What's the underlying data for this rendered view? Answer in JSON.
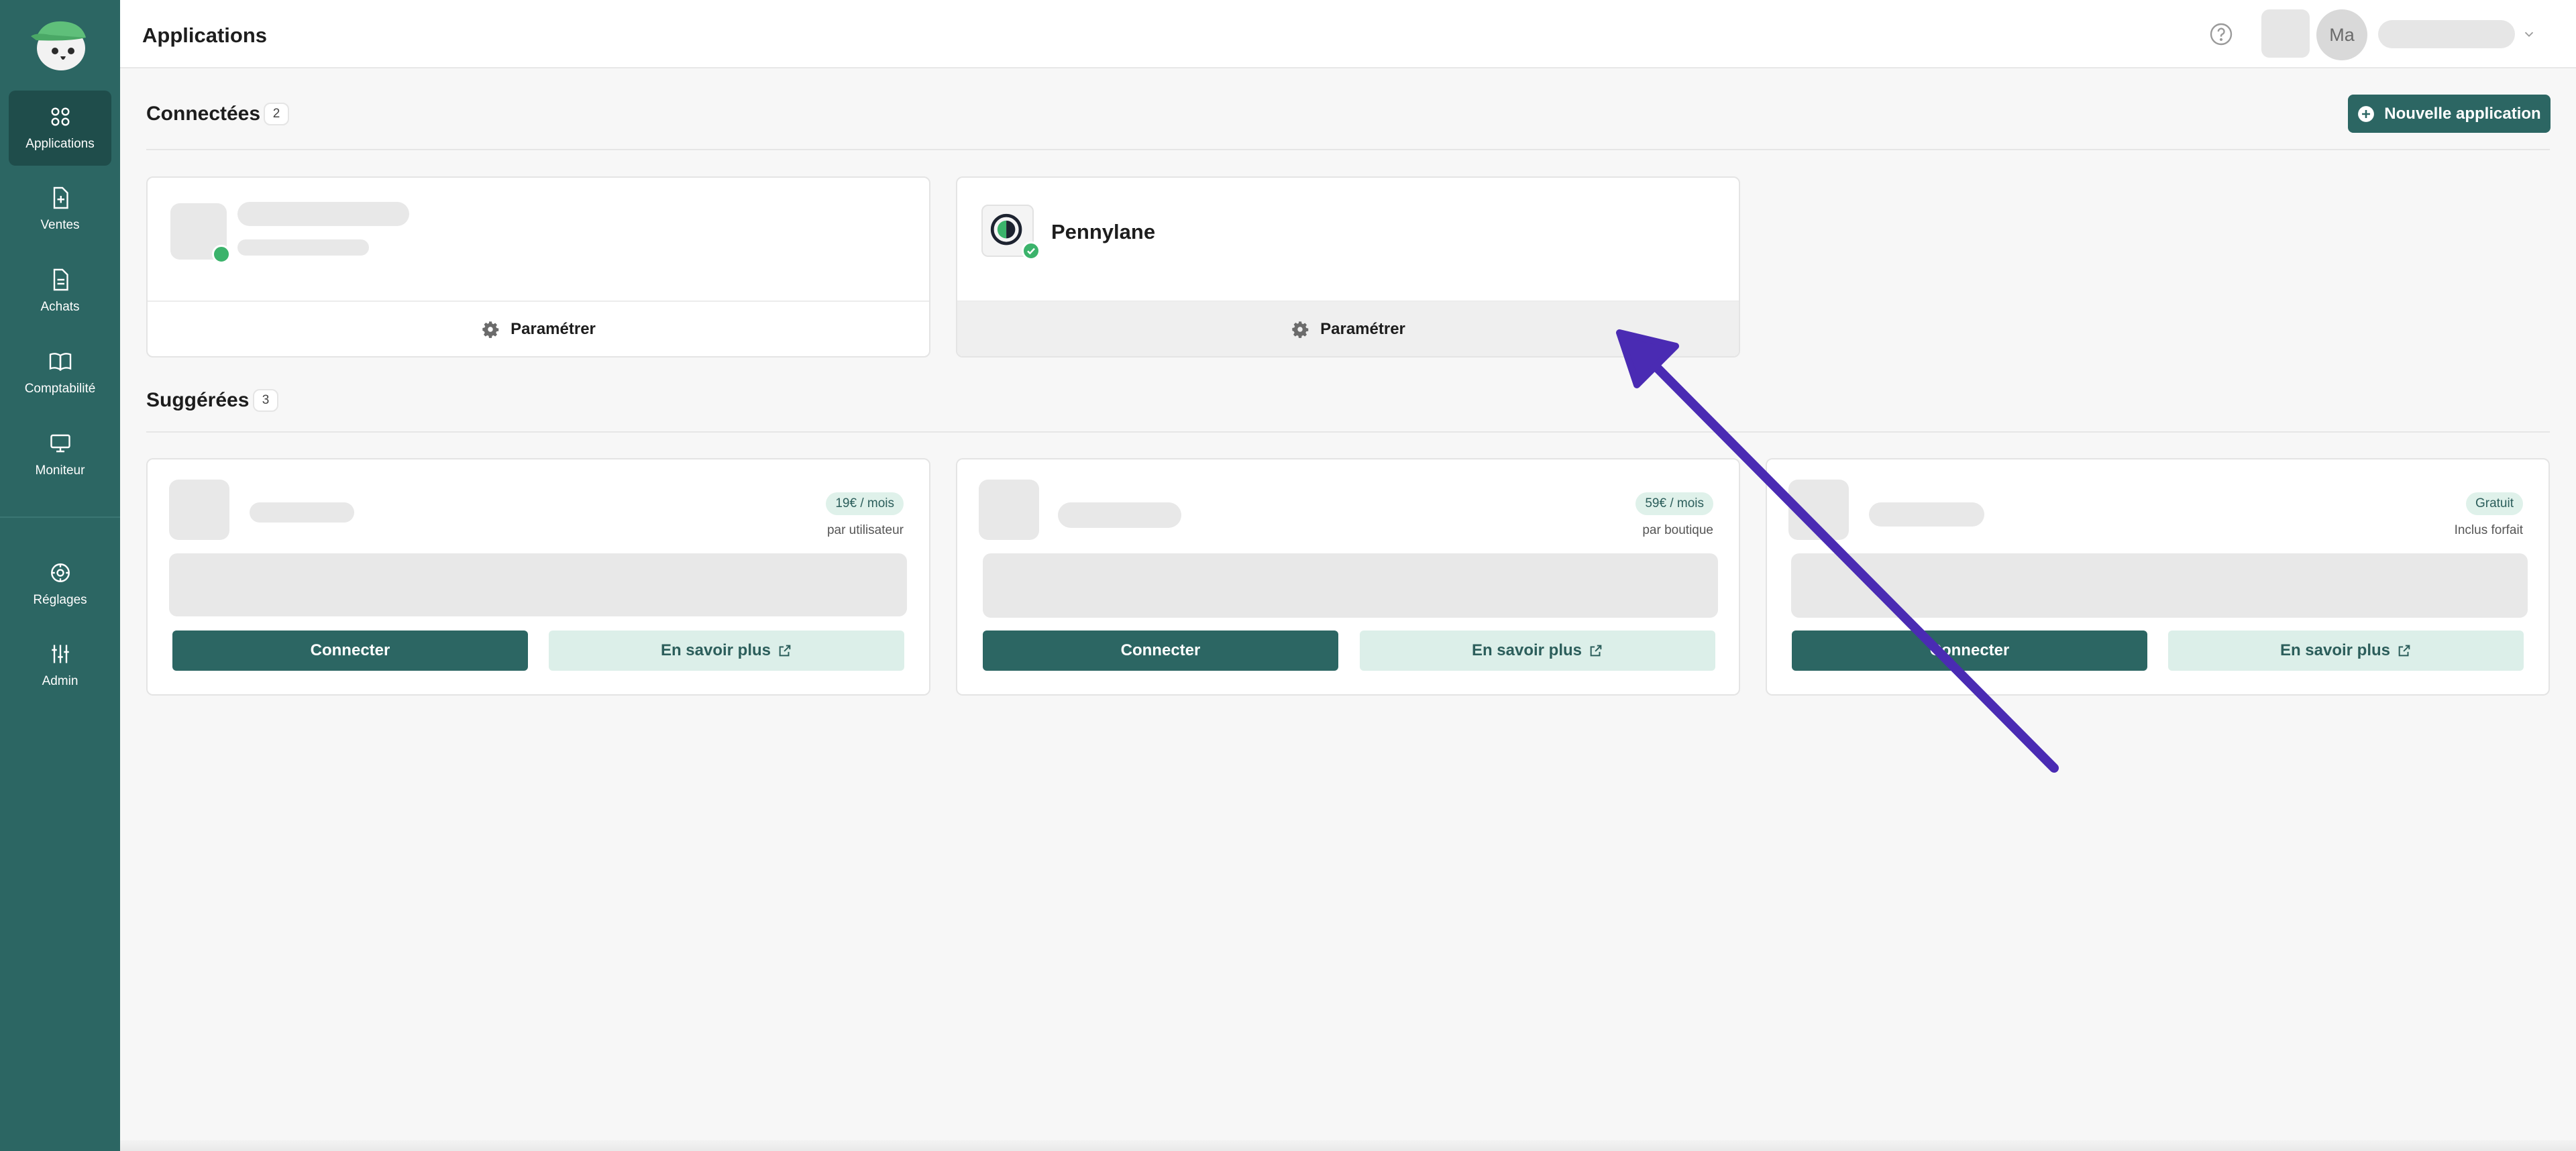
{
  "sidebar": {
    "items": [
      {
        "label": "Applications",
        "icon": "grid-icon"
      },
      {
        "label": "Ventes",
        "icon": "document-plus-icon"
      },
      {
        "label": "Achats",
        "icon": "document-icon"
      },
      {
        "label": "Comptabilité",
        "icon": "book-icon"
      },
      {
        "label": "Moniteur",
        "icon": "monitor-icon"
      },
      {
        "label": "Réglages",
        "icon": "gear-icon"
      },
      {
        "label": "Admin",
        "icon": "sliders-icon"
      }
    ]
  },
  "header": {
    "title": "Applications",
    "avatar_initials": "Ma"
  },
  "connected": {
    "title": "Connectées",
    "count": "2",
    "new_app_label": "Nouvelle application",
    "cards": [
      {
        "name": "",
        "action_label": "Paramétrer"
      },
      {
        "name": "Pennylane",
        "action_label": "Paramétrer"
      }
    ]
  },
  "suggested": {
    "title": "Suggérées",
    "count": "3",
    "cards": [
      {
        "price": "19€ / mois",
        "price_sub": "par utilisateur",
        "connect_label": "Connecter",
        "learn_label": "En savoir plus"
      },
      {
        "price": "59€ / mois",
        "price_sub": "par boutique",
        "connect_label": "Connecter",
        "learn_label": "En savoir plus"
      },
      {
        "price": "Gratuit",
        "price_sub": "Inclus forfait",
        "connect_label": "Connecter",
        "learn_label": "En savoir plus"
      }
    ]
  },
  "colors": {
    "brand": "#2c6663",
    "brand_dark": "#1f4d4b",
    "success": "#3bb36b",
    "annotation_arrow": "#4a2bb3"
  }
}
